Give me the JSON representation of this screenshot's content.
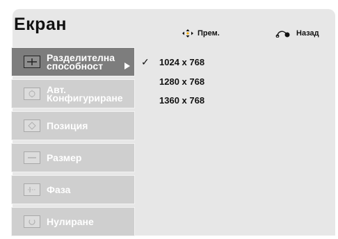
{
  "header": {
    "title": "Екран",
    "move_hint": "Прем.",
    "back_hint": "Назад"
  },
  "menu": [
    {
      "label_line1": "Разделителна",
      "label_line2": "способност",
      "icon": "crosshair-icon",
      "active": true
    },
    {
      "label_line1": "Авт.",
      "label_line2": "Конфигуриране",
      "icon": "auto-config-icon",
      "active": false
    },
    {
      "label_line1": "Позиция",
      "label_line2": "",
      "icon": "position-icon",
      "active": false
    },
    {
      "label_line1": "Размер",
      "label_line2": "",
      "icon": "size-icon",
      "active": false
    },
    {
      "label_line1": "Фаза",
      "label_line2": "",
      "icon": "phase-icon",
      "active": false
    },
    {
      "label_line1": "Нулиране",
      "label_line2": "",
      "icon": "reset-icon",
      "active": false
    }
  ],
  "resolutions": {
    "options": [
      "1024 x 768",
      "1280 x 768",
      "1360 x 768"
    ],
    "selected": "1024 x 768",
    "check_mark": "✓"
  },
  "colors": {
    "panel": "#e7e7e7",
    "menu_item": "#cfcfcf",
    "menu_item_active": "#7d7d7d",
    "text": "#111111"
  }
}
